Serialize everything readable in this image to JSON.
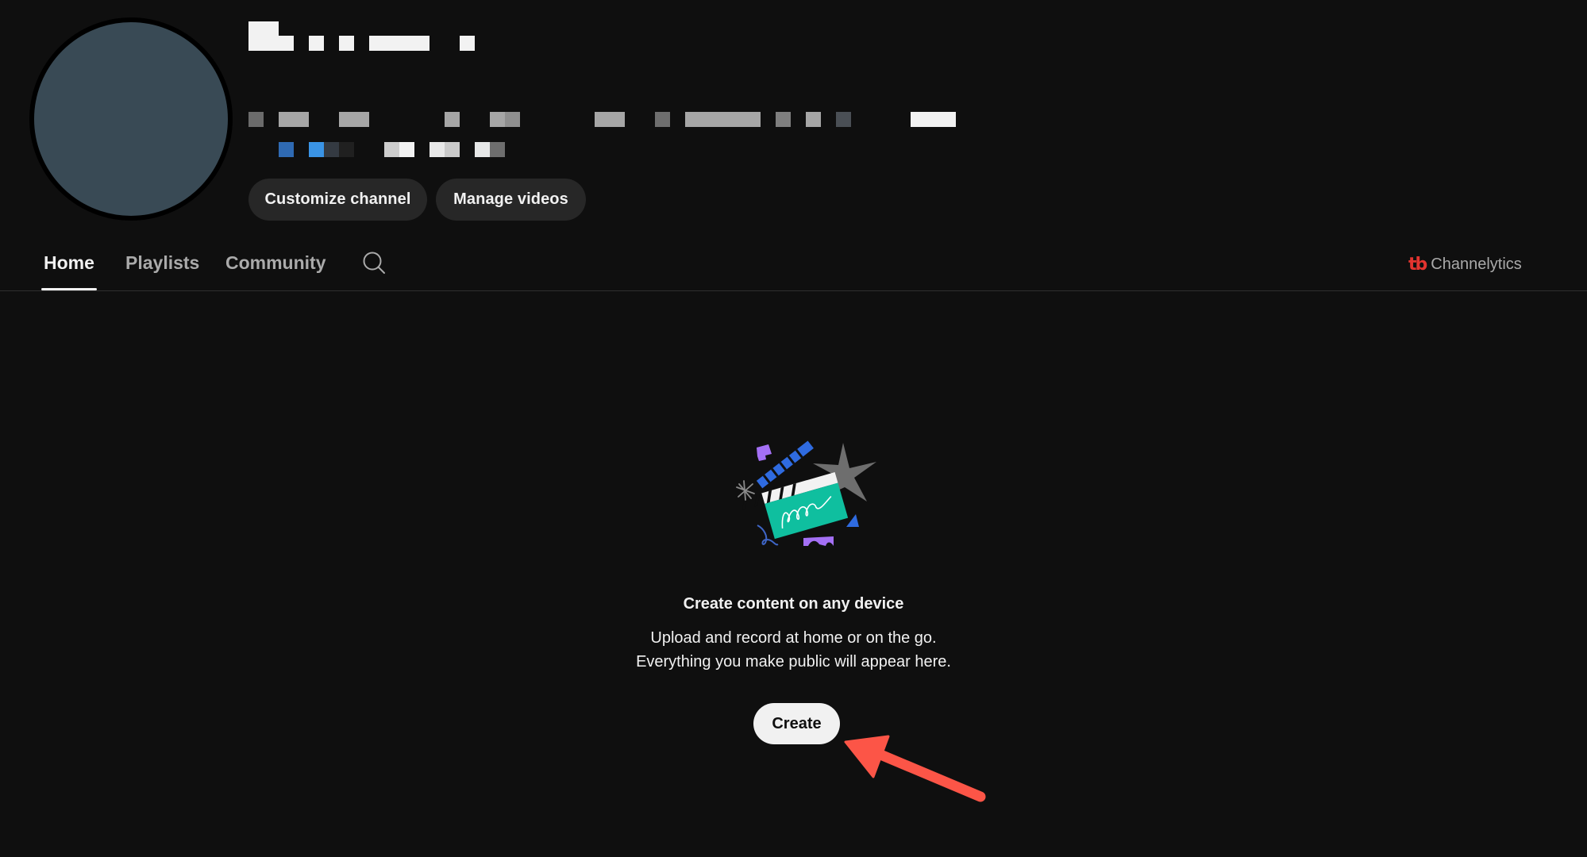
{
  "channel": {
    "name_redacted": true,
    "avatar_color": "#394a55",
    "title_blocks": [
      {
        "color": "#f2f2f2",
        "shape": "L"
      },
      {
        "color": "#f2f2f2"
      },
      {
        "color": "#f2f2f2"
      },
      {
        "color": "#f2f2f2"
      },
      {
        "color": "#f2f2f2"
      }
    ],
    "info_row1_colors": [
      "#6b6b6b",
      "#a6a6a6",
      "#a6a6a6",
      "#a6a6a6",
      "#a6a6a6",
      "#8f8f8f",
      "#a6a6a6",
      "#6e6e6e",
      "#a6a6a6",
      "#7f7f7f",
      "#a6a6a6",
      "#4a4f55",
      "#f2f2f2"
    ],
    "info_row2_colors": [
      "#2f6ab3",
      "#3a94e6",
      "#343a42",
      "#202020",
      "#cdcdcd",
      "#f2f2f2",
      "#e8e8e8",
      "#cacaca",
      "#e6e7e7",
      "#6e6e6e"
    ]
  },
  "actions": {
    "customize_label": "Customize channel",
    "manage_label": "Manage videos"
  },
  "tabs": [
    {
      "label": "Home",
      "active": true
    },
    {
      "label": "Playlists",
      "active": false
    },
    {
      "label": "Community",
      "active": false
    }
  ],
  "search_icon": "search-icon",
  "extension": {
    "logo_text": "tb",
    "label": "Channelytics",
    "logo_color": "#e3342f"
  },
  "empty_state": {
    "illustration": "clapperboard-illustration",
    "title": "Create content on any device",
    "line1": "Upload and record at home or on the go.",
    "line2": "Everything you make public will appear here.",
    "create_label": "Create"
  },
  "annotation": {
    "type": "arrow",
    "color": "#fc5547",
    "points_to": "create-button"
  }
}
